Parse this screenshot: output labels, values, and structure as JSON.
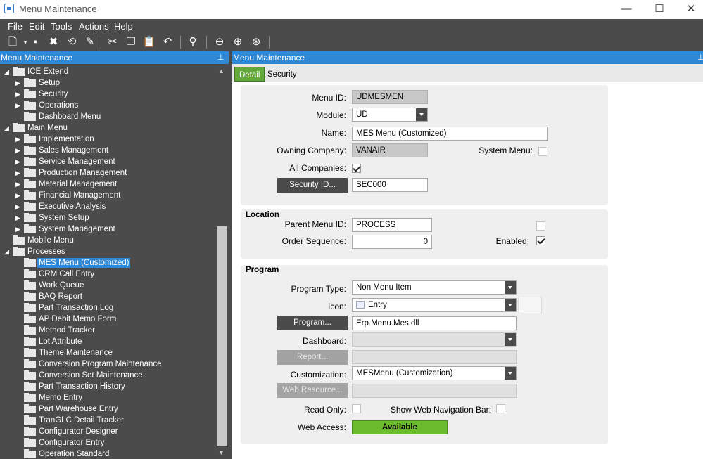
{
  "window": {
    "title": "Menu Maintenance",
    "minimize": "—",
    "maximize": "☐",
    "close": "✕"
  },
  "menubar": [
    "File",
    "Edit",
    "Tools",
    "Actions",
    "Help"
  ],
  "toolbar": {
    "icons": [
      "new-icon",
      "save-icon",
      "delete-icon",
      "refresh-icon",
      "clear-icon",
      "cut-icon",
      "copy-icon",
      "paste-icon",
      "undo-icon",
      "binoculars-icon",
      "back-icon",
      "forward-icon",
      "home-icon"
    ]
  },
  "left_panel": {
    "title": "Menu Maintenance",
    "tree": [
      {
        "label": "ICE Extend",
        "level": 0,
        "expanded": true
      },
      {
        "label": "Setup",
        "level": 1,
        "has_children": true
      },
      {
        "label": "Security",
        "level": 1,
        "has_children": true
      },
      {
        "label": "Operations",
        "level": 1,
        "has_children": true
      },
      {
        "label": "Dashboard Menu",
        "level": 1,
        "has_children": false
      },
      {
        "label": "Main Menu",
        "level": 0,
        "expanded": true
      },
      {
        "label": "Implementation",
        "level": 1,
        "has_children": true
      },
      {
        "label": "Sales Management",
        "level": 1,
        "has_children": true
      },
      {
        "label": "Service Management",
        "level": 1,
        "has_children": true
      },
      {
        "label": "Production Management",
        "level": 1,
        "has_children": true
      },
      {
        "label": "Material Management",
        "level": 1,
        "has_children": true
      },
      {
        "label": "Financial Management",
        "level": 1,
        "has_children": true
      },
      {
        "label": "Executive Analysis",
        "level": 1,
        "has_children": true
      },
      {
        "label": "System Setup",
        "level": 1,
        "has_children": true
      },
      {
        "label": "System Management",
        "level": 1,
        "has_children": true
      },
      {
        "label": "Mobile Menu",
        "level": 0,
        "expanded": false
      },
      {
        "label": "Processes",
        "level": 0,
        "expanded": true
      },
      {
        "label": "MES Menu (Customized)",
        "level": 1,
        "has_children": false,
        "selected": true
      },
      {
        "label": "CRM Call Entry",
        "level": 1,
        "has_children": false
      },
      {
        "label": "Work Queue",
        "level": 1,
        "has_children": false
      },
      {
        "label": "BAQ Report",
        "level": 1,
        "has_children": false
      },
      {
        "label": "Part Transaction Log",
        "level": 1,
        "has_children": false
      },
      {
        "label": "AP Debit Memo Form",
        "level": 1,
        "has_children": false
      },
      {
        "label": "Method Tracker",
        "level": 1,
        "has_children": false
      },
      {
        "label": "Lot Attribute",
        "level": 1,
        "has_children": false
      },
      {
        "label": "Theme Maintenance",
        "level": 1,
        "has_children": false
      },
      {
        "label": "Conversion Program Maintenance",
        "level": 1,
        "has_children": false
      },
      {
        "label": "Conversion Set Maintenance",
        "level": 1,
        "has_children": false
      },
      {
        "label": "Part Transaction History",
        "level": 1,
        "has_children": false
      },
      {
        "label": "Memo Entry",
        "level": 1,
        "has_children": false
      },
      {
        "label": "Part Warehouse Entry",
        "level": 1,
        "has_children": false
      },
      {
        "label": "TranGLC Detail Tracker",
        "level": 1,
        "has_children": false
      },
      {
        "label": "Configurator Designer",
        "level": 1,
        "has_children": false
      },
      {
        "label": "Configurator Entry",
        "level": 1,
        "has_children": false
      },
      {
        "label": "Operation Standard",
        "level": 1,
        "has_children": false
      }
    ]
  },
  "right_panel": {
    "title": "Menu Maintenance",
    "tabs": [
      "Detail",
      "Security"
    ],
    "detail": {
      "menu_id_label": "Menu ID:",
      "menu_id": "UDMESMEN",
      "module_label": "Module:",
      "module": "UD",
      "name_label": "Name:",
      "name": "MES Menu (Customized)",
      "owning_company_label": "Owning Company:",
      "owning_company": "VANAIR",
      "system_menu_label": "System Menu:",
      "system_menu": false,
      "all_companies_label": "All Companies:",
      "all_companies": true,
      "security_id_button": "Security ID...",
      "security_id": "SEC000"
    },
    "location": {
      "title": "Location",
      "parent_menu_id_label": "Parent Menu ID:",
      "parent_menu_id": "PROCESS",
      "order_sequence_label": "Order Sequence:",
      "order_sequence": "0",
      "enabled_label": "Enabled:",
      "enabled": true
    },
    "program": {
      "title": "Program",
      "program_type_label": "Program Type:",
      "program_type": "Non Menu Item",
      "icon_label": "Icon:",
      "icon": "Entry",
      "program_button": "Program...",
      "program": "Erp.Menu.Mes.dll",
      "dashboard_label": "Dashboard:",
      "dashboard": "",
      "report_button": "Report...",
      "report": "",
      "customization_label": "Customization:",
      "customization": "MESMenu (Customization)",
      "web_resource_button": "Web Resource...",
      "web_resource": "",
      "read_only_label": "Read Only:",
      "read_only": false,
      "show_web_nav_label": "Show Web Navigation Bar:",
      "show_web_nav": false,
      "web_access_label": "Web Access:",
      "web_access": "Available"
    }
  }
}
